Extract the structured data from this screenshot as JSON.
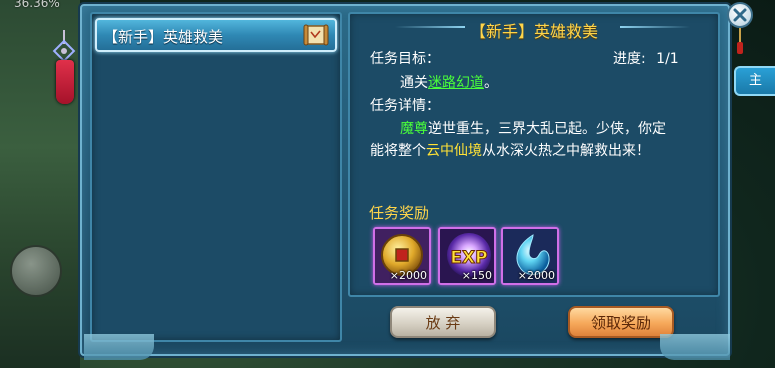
{
  "hud": {
    "percent": "36.36%"
  },
  "quest_list": {
    "items": [
      {
        "label": "【新手】英雄救美",
        "icon": "scroll-icon",
        "selected": true
      }
    ]
  },
  "quest_detail": {
    "title": "【新手】英雄救美",
    "objective_label": "任务目标：",
    "progress_label": "进度:",
    "progress_value": "1/1",
    "objective_prefix": "通关",
    "objective_target": "迷路幻道",
    "objective_suffix": "。",
    "details_label": "任务详情：",
    "detail_part1": "魔尊",
    "detail_part2": "逆世重生，三界大乱已起。少侠，你定",
    "detail_part3": "能将整个",
    "detail_part4": "云中仙境",
    "detail_part5": "从水深火热之中解救出来！"
  },
  "rewards": {
    "heading": "任务奖励",
    "items": [
      {
        "icon": "copper-coin-icon",
        "count": "×2000"
      },
      {
        "icon": "exp-orb-icon",
        "count": "×150",
        "label": "EXP"
      },
      {
        "icon": "spirit-drop-icon",
        "count": "×2000"
      }
    ]
  },
  "buttons": {
    "abandon": "放 弃",
    "claim": "领取奖励"
  },
  "side_tab": {
    "label": "主"
  },
  "colors": {
    "highlight_green": "#49ff3a",
    "highlight_yellow": "#ffe236",
    "title_gold": "#ffd54a",
    "panel_blue": "#215571"
  }
}
